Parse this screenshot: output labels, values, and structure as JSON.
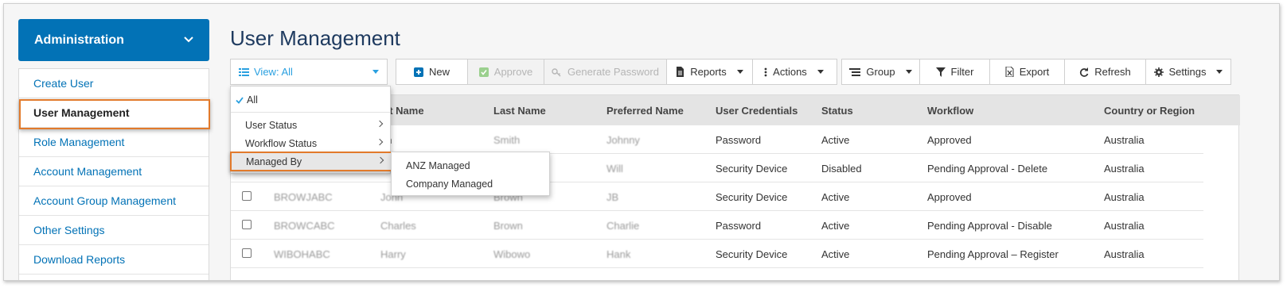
{
  "sidebar": {
    "header": "Administration",
    "items": [
      {
        "label": "Create User"
      },
      {
        "label": "User Management"
      },
      {
        "label": "Role Management"
      },
      {
        "label": "Account Management"
      },
      {
        "label": "Account Group Management"
      },
      {
        "label": "Other Settings"
      },
      {
        "label": "Download Reports"
      }
    ]
  },
  "page_title": "User Management",
  "toolbar": {
    "view_label": "View: All",
    "new": "New",
    "approve": "Approve",
    "generate_password": "Generate Password",
    "reports": "Reports",
    "actions": "Actions",
    "group": "Group",
    "filter": "Filter",
    "export": "Export",
    "refresh": "Refresh",
    "settings": "Settings"
  },
  "view_menu": {
    "all": "All",
    "user_status": "User Status",
    "workflow_status": "Workflow Status",
    "managed_by": "Managed By",
    "managed_by_options": [
      "ANZ Managed",
      "Company Managed"
    ]
  },
  "table": {
    "columns": [
      "st Name",
      "Last Name",
      "Preferred Name",
      "User Credentials",
      "Status",
      "Workflow",
      "Country or Region"
    ],
    "rows": [
      {
        "id": "",
        "first": "hn",
        "last": "Smith",
        "preferred": "Johnny",
        "credentials": "Password",
        "status": "Active",
        "workflow": "Approved",
        "country": "Australia"
      },
      {
        "id": "",
        "first": "",
        "last": "",
        "preferred": "Will",
        "credentials": "Security Device",
        "status": "Disabled",
        "workflow": "Pending Approval - Delete",
        "country": "Australia"
      },
      {
        "id": "BROWJABC",
        "first": "John",
        "last": "Brown",
        "preferred": "JB",
        "credentials": "Security Device",
        "status": "Active",
        "workflow": "Approved",
        "country": "Australia"
      },
      {
        "id": "BROWCABC",
        "first": "Charles",
        "last": "Brown",
        "preferred": "Charlie",
        "credentials": "Password",
        "status": "Active",
        "workflow": "Pending Approval - Disable",
        "country": "Australia"
      },
      {
        "id": "WIBOHABC",
        "first": "Harry",
        "last": "Wibowo",
        "preferred": "Hank",
        "credentials": "Security Device",
        "status": "Active",
        "workflow": "Pending Approval – Register",
        "country": "Australia"
      }
    ]
  },
  "colors": {
    "brand": "#0272b6",
    "highlight": "#e27a2b",
    "link": "#2aa0e0"
  }
}
